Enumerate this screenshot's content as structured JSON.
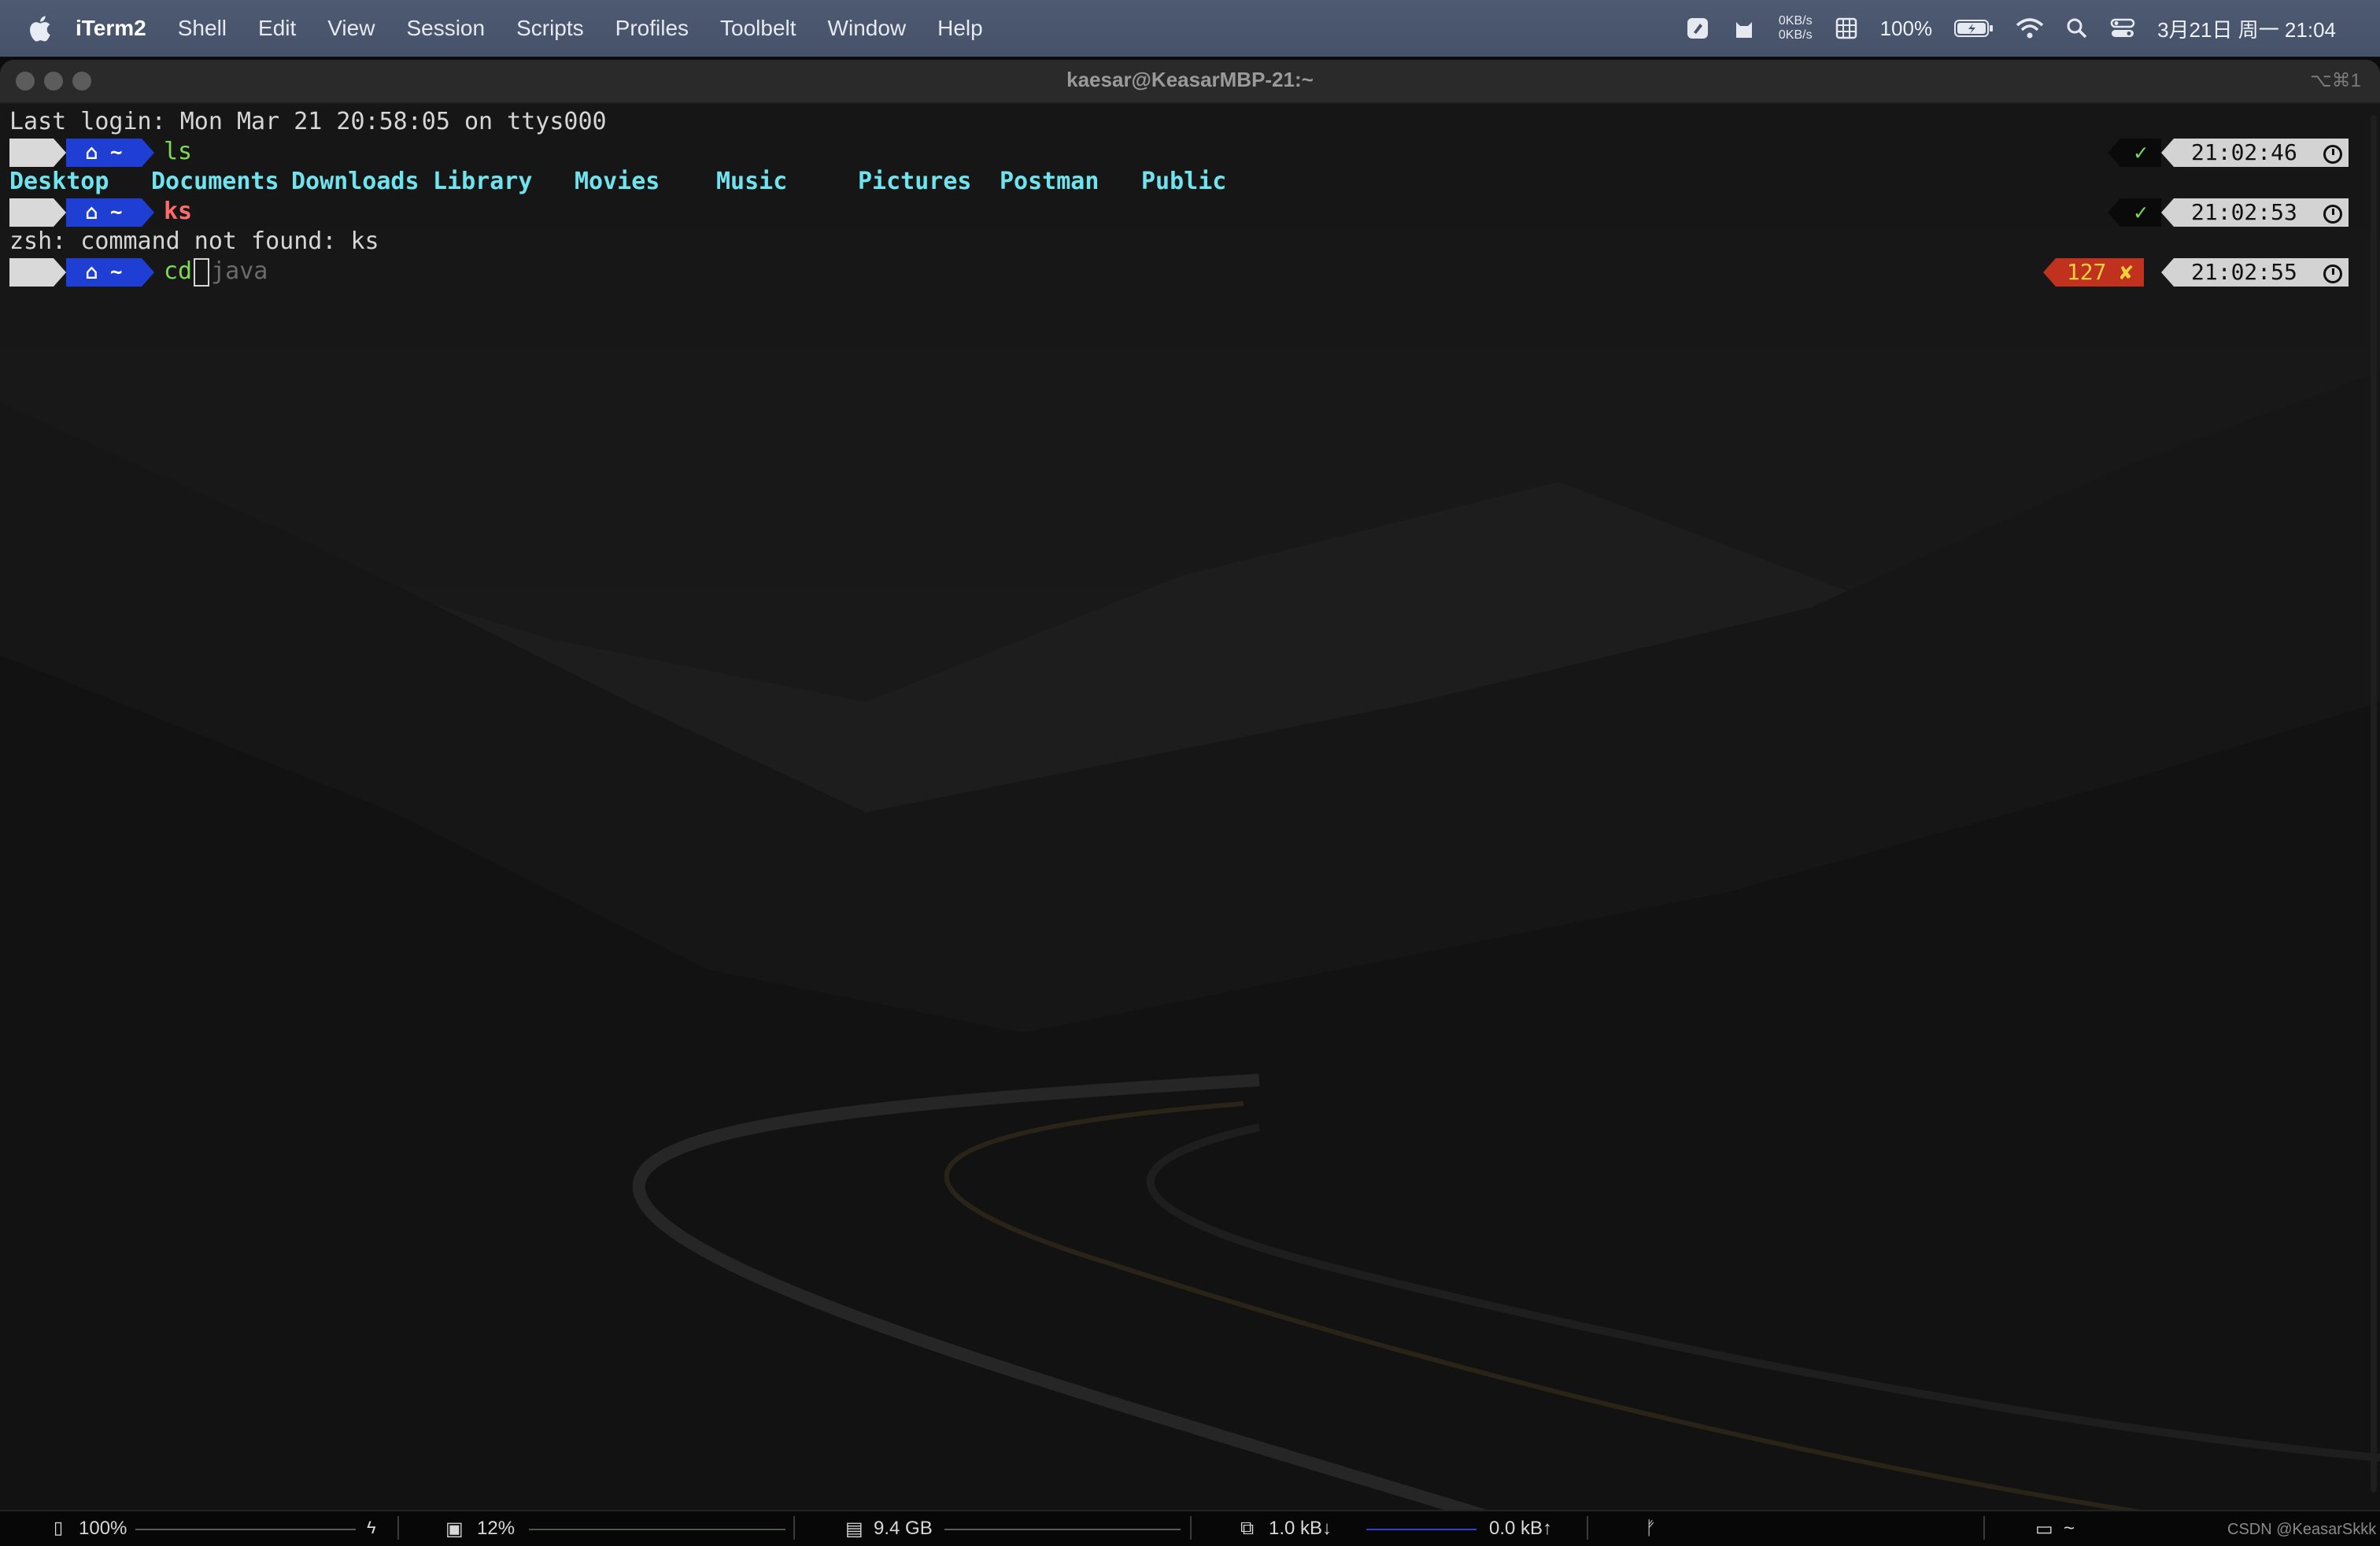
{
  "menubar": {
    "app_name": "iTerm2",
    "items": [
      "Shell",
      "Edit",
      "View",
      "Session",
      "Scripts",
      "Profiles",
      "Toolbelt",
      "Window",
      "Help"
    ],
    "netspeed_up": "0KB/s",
    "netspeed_down": "0KB/s",
    "battery_percent": "100%",
    "datetime": "3月21日 周一 21:04"
  },
  "window": {
    "title": "kaesar@KeasarMBP-21:~",
    "shortcut": "⌥⌘1"
  },
  "terminal": {
    "last_login": "Last login: Mon Mar 21 20:58:05 on ttys000",
    "prompt_dir": "~",
    "prompts": [
      {
        "command": "ls",
        "command_color": "#7ed957",
        "status": "✓",
        "time": "21:02:46"
      },
      {
        "command": "ks",
        "command_color": "#ff6b6b",
        "status": "✓",
        "time": "21:02:53"
      },
      {
        "command": "cd",
        "command_color": "#7ed957",
        "suggestion": "java",
        "status": "127 ✘",
        "time": "21:02:55"
      }
    ],
    "ls_output": [
      "Desktop",
      "Documents",
      "Downloads",
      "Library",
      "Movies",
      "Music",
      "Pictures",
      "Postman",
      "Public"
    ],
    "error_line": "zsh: command not found: ks"
  },
  "statusbar": {
    "battery": "100%",
    "cpu": "12%",
    "memory": "9.4 GB",
    "net_down": "1.0 kB↓",
    "net_up": "0.0 kB↑",
    "branch_icon": "ᚠ",
    "folder": "~",
    "watermark": "CSDN @KeasarSkkk"
  },
  "colors": {
    "accent_blue": "#1f3fd4",
    "error_red": "#c0321e",
    "dir_cyan": "#6fe3ee",
    "ok_green": "#7ed957"
  }
}
